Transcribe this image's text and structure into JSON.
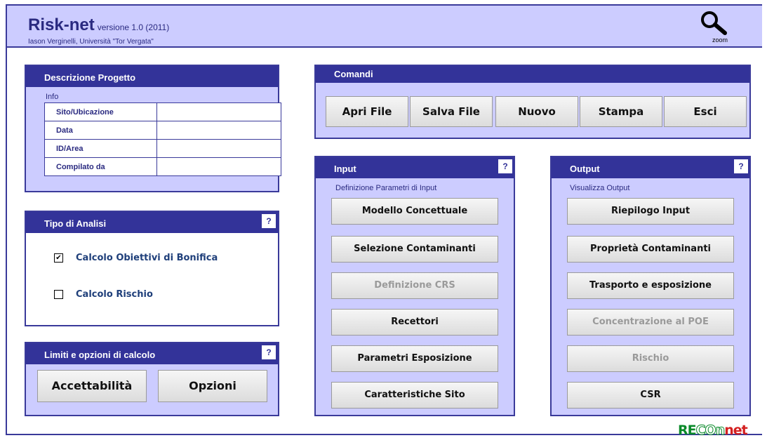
{
  "app": {
    "title": "Risk-net",
    "version": "versione 1.0 (2011)",
    "author": "Iason Verginelli, Università \"Tor Vergata\"",
    "zoom_label": "zoom"
  },
  "descrizione": {
    "title": "Descrizione Progetto",
    "sublabel": "Info",
    "rows": [
      {
        "label": "Sito/Ubicazione",
        "value": ""
      },
      {
        "label": "Data",
        "value": ""
      },
      {
        "label": "ID/Area",
        "value": ""
      },
      {
        "label": "Compilato da",
        "value": ""
      }
    ]
  },
  "tipo_analisi": {
    "title": "Tipo di Analisi",
    "help": "?",
    "options": [
      {
        "label": "Calcolo Obiettivi di Bonifica",
        "checked": true
      },
      {
        "label": "Calcolo Rischio",
        "checked": false
      }
    ]
  },
  "limiti": {
    "title": "Limiti e opzioni di calcolo",
    "help": "?",
    "buttons": [
      "Accettabilità",
      "Opzioni"
    ]
  },
  "comandi": {
    "title": "Comandi",
    "buttons": [
      "Apri File",
      "Salva File",
      "Nuovo",
      "Stampa",
      "Esci"
    ]
  },
  "input": {
    "title": "Input",
    "help": "?",
    "sublabel": "Definizione Parametri di Input",
    "buttons": [
      {
        "label": "Modello Concettuale",
        "enabled": true
      },
      {
        "label": "Selezione Contaminanti",
        "enabled": true
      },
      {
        "label": "Definizione CRS",
        "enabled": false
      },
      {
        "label": "Recettori",
        "enabled": true
      },
      {
        "label": "Parametri Esposizione",
        "enabled": true
      },
      {
        "label": "Caratteristiche Sito",
        "enabled": true
      }
    ]
  },
  "output": {
    "title": "Output",
    "help": "?",
    "sublabel": "Visualizza Output",
    "buttons": [
      {
        "label": "Riepilogo Input",
        "enabled": true
      },
      {
        "label": "Proprietà Contaminanti",
        "enabled": true
      },
      {
        "label": "Trasporto e esposizione",
        "enabled": true
      },
      {
        "label": "Concentrazione al POE",
        "enabled": false
      },
      {
        "label": "Rischio",
        "enabled": false
      },
      {
        "label": "CSR",
        "enabled": true
      }
    ]
  },
  "logo": {
    "part1": "RE",
    "part2": "CO",
    "part3": "n",
    "part4": "net"
  },
  "colors": {
    "panel_bg": "#ccccff",
    "panel_header": "#333399",
    "border": "#3a3a9a",
    "logo_green": "#0a8a2a",
    "logo_red": "#d42020"
  }
}
